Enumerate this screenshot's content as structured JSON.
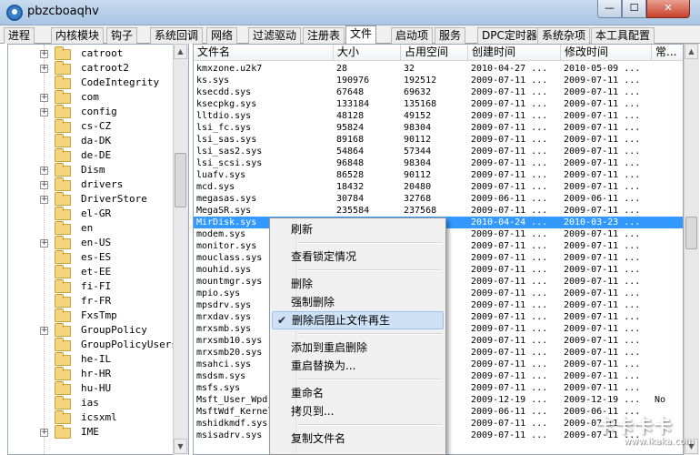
{
  "window": {
    "title": "pbzcboaqhv",
    "min_glyph": "—",
    "max_glyph": "☐",
    "close_glyph": "✕"
  },
  "tabs": [
    "进程",
    "内核模块",
    "钩子",
    "系统回调",
    "网络",
    "过滤驱动",
    "注册表",
    "文件",
    "启动项",
    "服务",
    "DPC定时器",
    "系统杂项",
    "本工具配置"
  ],
  "active_tab": "文件",
  "tree": {
    "items": [
      {
        "label": "catroot",
        "expandable": true
      },
      {
        "label": "catroot2",
        "expandable": true
      },
      {
        "label": "CodeIntegrity",
        "expandable": false
      },
      {
        "label": "com",
        "expandable": true
      },
      {
        "label": "config",
        "expandable": true
      },
      {
        "label": "cs-CZ",
        "expandable": false
      },
      {
        "label": "da-DK",
        "expandable": false
      },
      {
        "label": "de-DE",
        "expandable": false
      },
      {
        "label": "Dism",
        "expandable": true
      },
      {
        "label": "drivers",
        "expandable": true
      },
      {
        "label": "DriverStore",
        "expandable": true
      },
      {
        "label": "el-GR",
        "expandable": false
      },
      {
        "label": "en",
        "expandable": false
      },
      {
        "label": "en-US",
        "expandable": true
      },
      {
        "label": "es-ES",
        "expandable": false
      },
      {
        "label": "et-EE",
        "expandable": false
      },
      {
        "label": "fi-FI",
        "expandable": false
      },
      {
        "label": "fr-FR",
        "expandable": false
      },
      {
        "label": "FxsTmp",
        "expandable": false
      },
      {
        "label": "GroupPolicy",
        "expandable": true
      },
      {
        "label": "GroupPolicyUsers",
        "expandable": false
      },
      {
        "label": "he-IL",
        "expandable": false
      },
      {
        "label": "hr-HR",
        "expandable": false
      },
      {
        "label": "hu-HU",
        "expandable": false
      },
      {
        "label": "ias",
        "expandable": false
      },
      {
        "label": "icsxml",
        "expandable": false
      },
      {
        "label": "IME",
        "expandable": true
      }
    ]
  },
  "file_list": {
    "columns": [
      "文件名",
      "大小",
      "占用空间",
      "创建时间",
      "修改时间",
      "常..."
    ],
    "rows": [
      [
        "kmxzone.u2k7",
        "28",
        "32",
        "2010-04-27 ...",
        "2010-05-09 ...",
        ""
      ],
      [
        "ks.sys",
        "190976",
        "192512",
        "2009-07-11 ...",
        "2009-07-11 ...",
        ""
      ],
      [
        "ksecdd.sys",
        "67648",
        "69632",
        "2009-07-11 ...",
        "2009-07-11 ...",
        ""
      ],
      [
        "ksecpkg.sys",
        "133184",
        "135168",
        "2009-07-11 ...",
        "2009-07-11 ...",
        ""
      ],
      [
        "lltdio.sys",
        "48128",
        "49152",
        "2009-07-11 ...",
        "2009-07-11 ...",
        ""
      ],
      [
        "lsi_fc.sys",
        "95824",
        "98304",
        "2009-07-11 ...",
        "2009-07-11 ...",
        ""
      ],
      [
        "lsi_sas.sys",
        "89168",
        "90112",
        "2009-07-11 ...",
        "2009-07-11 ...",
        ""
      ],
      [
        "lsi_sas2.sys",
        "54864",
        "57344",
        "2009-07-11 ...",
        "2009-07-11 ...",
        ""
      ],
      [
        "lsi_scsi.sys",
        "96848",
        "98304",
        "2009-07-11 ...",
        "2009-07-11 ...",
        ""
      ],
      [
        "luafv.sys",
        "86528",
        "90112",
        "2009-07-11 ...",
        "2009-07-11 ...",
        ""
      ],
      [
        "mcd.sys",
        "18432",
        "20480",
        "2009-07-11 ...",
        "2009-07-11 ...",
        ""
      ],
      [
        "megasas.sys",
        "30784",
        "32768",
        "2009-06-11 ...",
        "2009-06-11 ...",
        ""
      ],
      [
        "MegaSR.sys",
        "235584",
        "237568",
        "2009-07-11 ...",
        "2009-07-11 ...",
        ""
      ],
      [
        "MirDisk.sys",
        "",
        "",
        "2010-04-24 ...",
        "2010-03-23 ...",
        ""
      ],
      [
        "modem.sys",
        "",
        "",
        "2009-07-11 ...",
        "2009-07-11 ...",
        ""
      ],
      [
        "monitor.sys",
        "",
        "",
        "2009-07-11 ...",
        "2009-07-11 ...",
        ""
      ],
      [
        "mouclass.sys",
        "",
        "",
        "2009-07-11 ...",
        "2009-07-11 ...",
        ""
      ],
      [
        "mouhid.sys",
        "",
        "",
        "2009-07-11 ...",
        "2009-07-11 ...",
        ""
      ],
      [
        "mountmgr.sys",
        "",
        "",
        "2009-07-11 ...",
        "2009-07-11 ...",
        ""
      ],
      [
        "mpio.sys",
        "",
        "",
        "2009-07-11 ...",
        "2009-07-11 ...",
        ""
      ],
      [
        "mpsdrv.sys",
        "",
        "",
        "2009-07-11 ...",
        "2009-07-11 ...",
        ""
      ],
      [
        "mrxdav.sys",
        "",
        "",
        "2009-07-11 ...",
        "2009-07-11 ...",
        ""
      ],
      [
        "mrxsmb.sys",
        "",
        "",
        "2009-07-11 ...",
        "2009-07-11 ...",
        ""
      ],
      [
        "mrxsmb10.sys",
        "",
        "",
        "2009-07-11 ...",
        "2009-07-11 ...",
        ""
      ],
      [
        "mrxsmb20.sys",
        "",
        "",
        "2009-07-11 ...",
        "2009-07-11 ...",
        ""
      ],
      [
        "msahci.sys",
        "",
        "",
        "2009-07-11 ...",
        "2009-07-11 ...",
        ""
      ],
      [
        "msdsm.sys",
        "",
        "",
        "2009-07-11 ...",
        "2009-07-11 ...",
        ""
      ],
      [
        "msfs.sys",
        "",
        "",
        "2009-07-11 ...",
        "2009-07-11 ...",
        ""
      ],
      [
        "Msft_User_Wpd...",
        "",
        "",
        "2009-12-19 ...",
        "2009-12-19 ...",
        "No"
      ],
      [
        "MsftWdf_Kernel...",
        "",
        "",
        "2009-06-11 ...",
        "2009-06-11 ...",
        ""
      ],
      [
        "mshidkmdf.sys",
        "",
        "",
        "2009-07-11 ...",
        "2009-07-11 ...",
        ""
      ],
      [
        "msisadrv.sys",
        "",
        "",
        "2009-07-11 ...",
        "2009-07-11 ...",
        ""
      ]
    ],
    "selected_row": 13
  },
  "context_menu": {
    "items": [
      {
        "label": "刷新",
        "type": "item"
      },
      {
        "type": "separator"
      },
      {
        "label": "查看锁定情况",
        "type": "item"
      },
      {
        "type": "separator"
      },
      {
        "label": "删除",
        "type": "item"
      },
      {
        "label": "强制删除",
        "type": "item"
      },
      {
        "label": "删除后阻止文件再生",
        "type": "item",
        "checked": true,
        "hover": true
      },
      {
        "type": "separator"
      },
      {
        "label": "添加到重启删除",
        "type": "item"
      },
      {
        "label": "重启替换为...",
        "type": "item"
      },
      {
        "type": "separator"
      },
      {
        "label": "重命名",
        "type": "item"
      },
      {
        "label": "拷贝到...",
        "type": "item"
      },
      {
        "type": "separator"
      },
      {
        "label": "复制文件名",
        "type": "item"
      }
    ]
  },
  "watermark": {
    "big": "卡卡卡卡",
    "small": "www.ikaka.com"
  },
  "colors": {
    "selection": "#3399ff",
    "menu_hover": "#cde0f4",
    "folder": "#f4d47c"
  }
}
